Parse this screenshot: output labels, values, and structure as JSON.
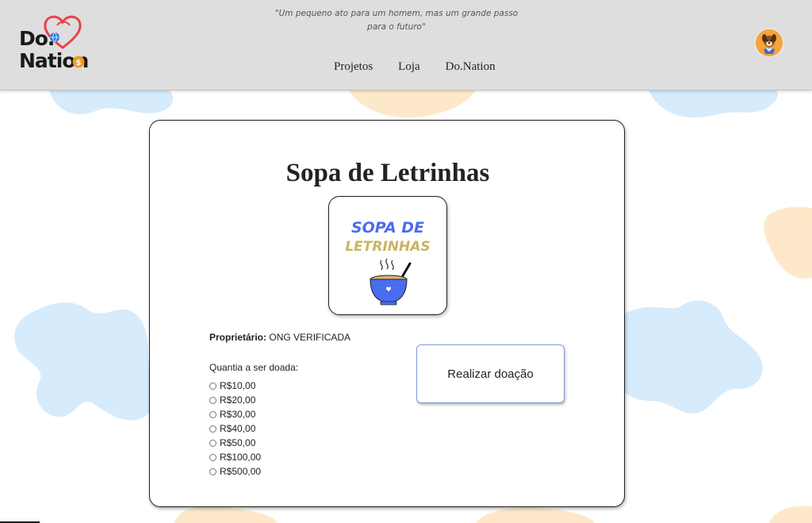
{
  "header": {
    "logo_line1": "Do.",
    "logo_line2": "Nation",
    "quote_line1": "\"Um pequeno ato para um homem, mas um grande passo",
    "quote_line2": "para o futuro\"",
    "nav": [
      "Projetos",
      "Loja",
      "Do.Nation"
    ],
    "avatar_icon": "dog-avatar-icon"
  },
  "project": {
    "title": "Sopa de Letrinhas",
    "image_text_line1": "SOPA DE",
    "image_text_line2": "LETRINHAS",
    "owner_label": "Proprietário:",
    "owner_value": "ONG VERIFICADA",
    "amount_label": "Quantia a ser doada:",
    "amounts": [
      "R$10,00",
      "R$20,00",
      "R$30,00",
      "R$40,00",
      "R$50,00",
      "R$100,00",
      "R$500,00"
    ],
    "donate_label": "Realizar doação"
  },
  "colors": {
    "header_bg": "#dedede",
    "blob_blue": "#d6ebfb",
    "blob_peach": "#fde9c9",
    "accent_blue": "#4a6cf0",
    "logo_red": "#e8424a",
    "logo_orange": "#f39a1e"
  }
}
